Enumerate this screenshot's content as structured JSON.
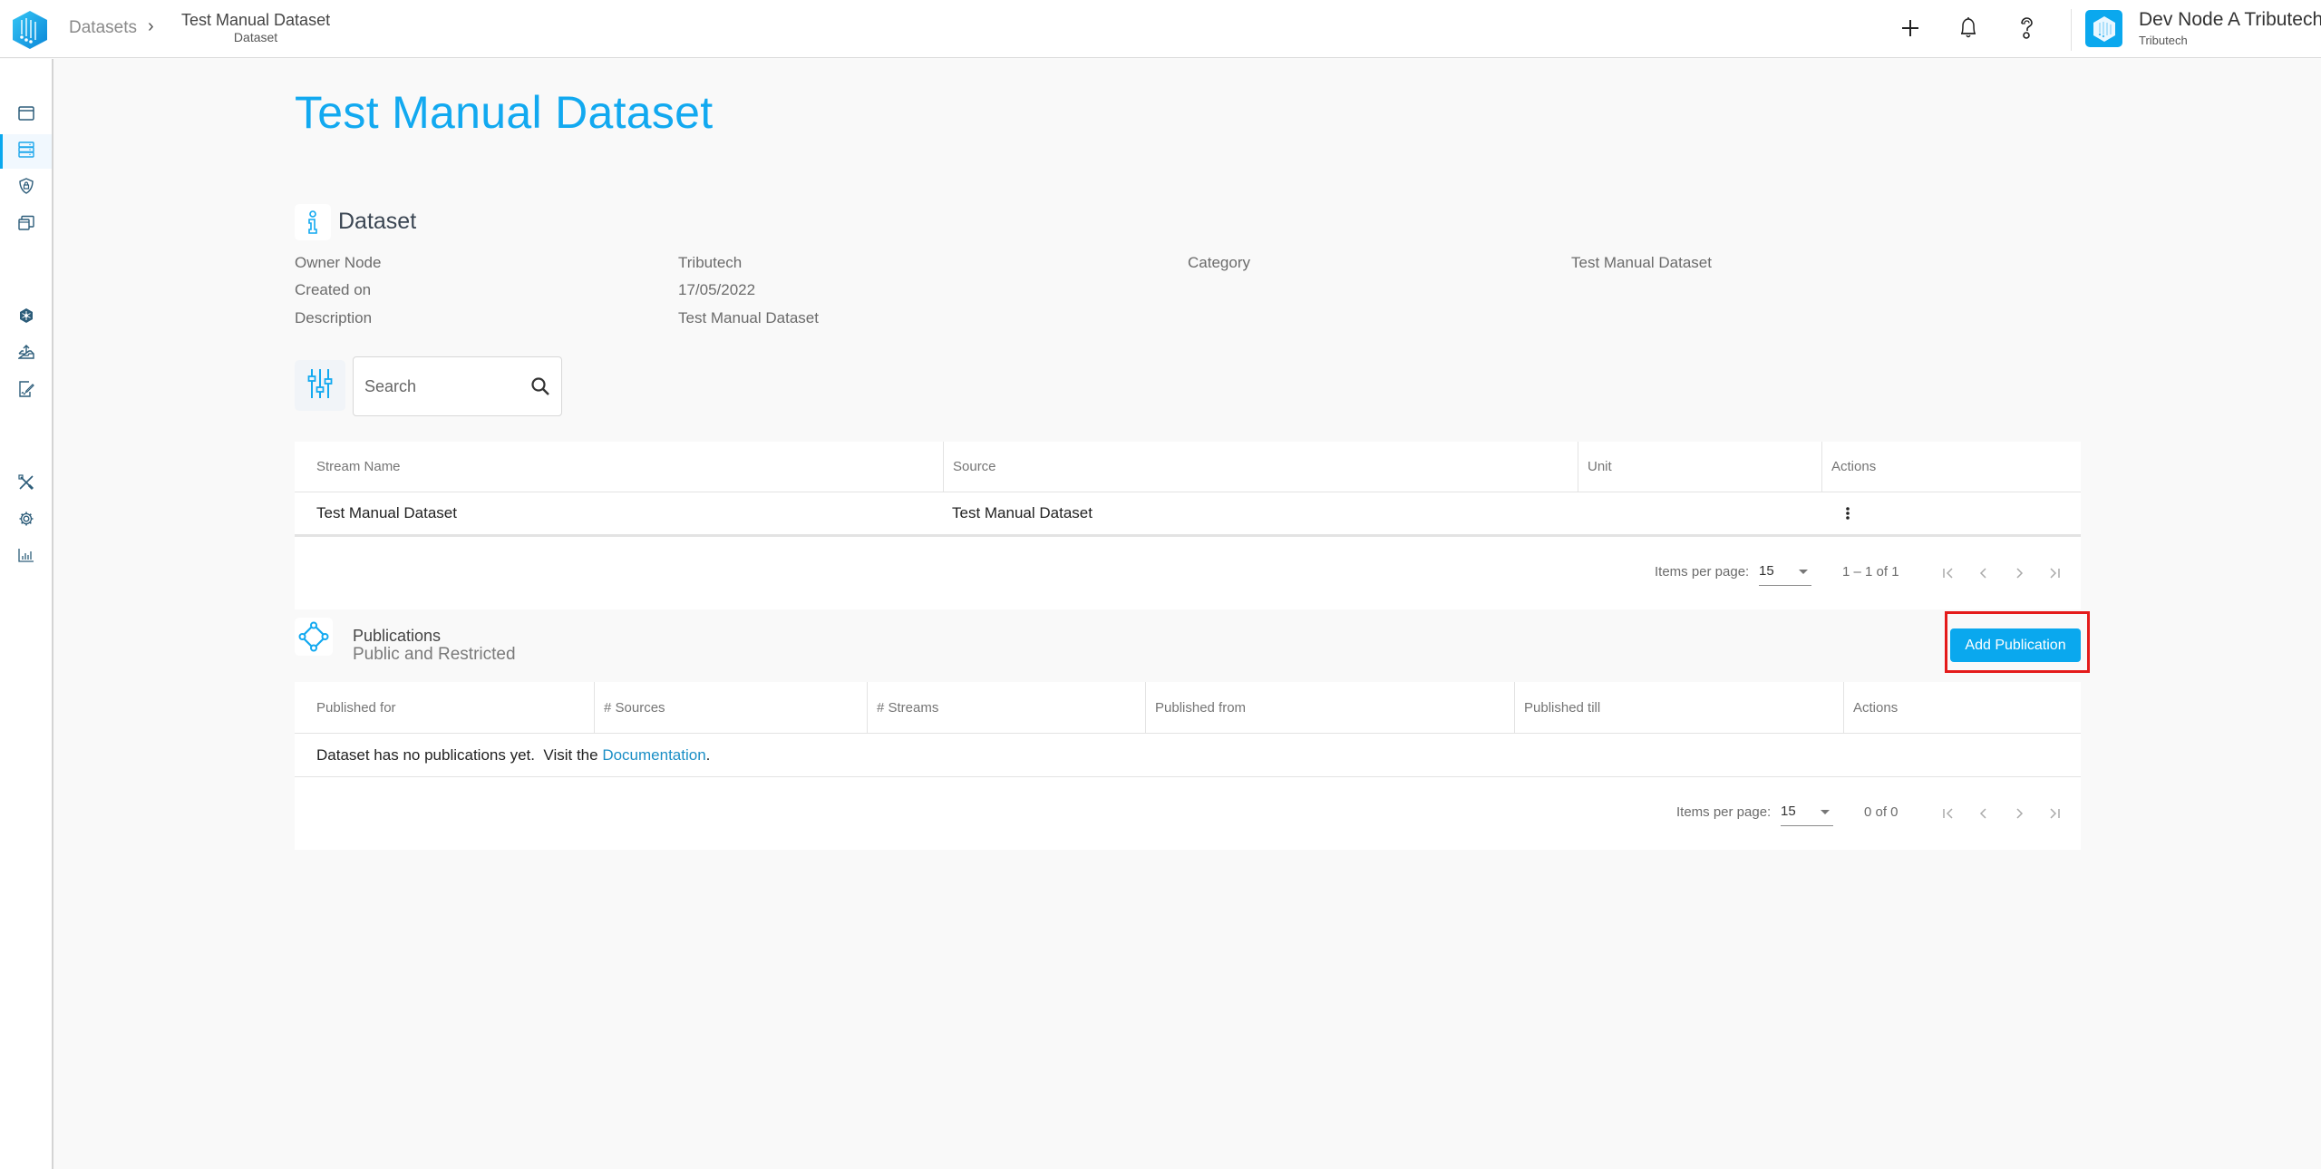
{
  "header": {
    "breadcrumb": {
      "root": "Datasets",
      "separator": "›",
      "current_title": "Test Manual Dataset",
      "current_subtitle": "Dataset"
    },
    "icons": [
      "plus-icon",
      "bell-icon",
      "help-icon"
    ],
    "user": {
      "name": "Dev Node A Tributech",
      "org": "Tributech"
    }
  },
  "sidebar": {
    "items": [
      {
        "icon": "window-icon",
        "active": false
      },
      {
        "icon": "datasets-icon",
        "active": true
      },
      {
        "icon": "shield-lock-icon",
        "active": false
      },
      {
        "icon": "stacked-windows-icon",
        "active": false
      },
      {
        "icon": "network-cube-icon",
        "active": false
      },
      {
        "icon": "upload-tray-icon",
        "active": false
      },
      {
        "icon": "document-edit-icon",
        "active": false
      },
      {
        "icon": "tools-icon",
        "active": false
      },
      {
        "icon": "gear-icon",
        "active": false
      },
      {
        "icon": "bar-chart-icon",
        "active": false
      }
    ]
  },
  "page": {
    "title": "Test Manual Dataset",
    "section_title": "Dataset",
    "meta": {
      "owner_node_label": "Owner Node",
      "owner_node_value": "Tributech",
      "created_on_label": "Created on",
      "created_on_value": "17/05/2022",
      "description_label": "Description",
      "description_value": "Test Manual Dataset",
      "category_label": "Category",
      "category_value": "Test Manual Dataset"
    },
    "search": {
      "placeholder": "Search",
      "value": ""
    }
  },
  "streams_table": {
    "columns": [
      "Stream Name",
      "Source",
      "Unit",
      "Actions"
    ],
    "rows": [
      {
        "stream_name": "Test Manual Dataset",
        "source": "Test Manual Dataset",
        "unit": "",
        "actions": "more-vert-icon"
      }
    ],
    "paginator": {
      "items_per_page_label": "Items per page:",
      "items_per_page": "15",
      "range": "1 – 1 of 1"
    }
  },
  "publications": {
    "title": "Publications",
    "subtitle": "Public and Restricted",
    "add_button": "Add Publication",
    "columns": [
      "Published for",
      "# Sources",
      "# Streams",
      "Published from",
      "Published till",
      "Actions"
    ],
    "empty_text": "Dataset has no publications yet.  Visit the ",
    "empty_link": "Documentation",
    "empty_suffix": ".",
    "paginator": {
      "items_per_page_label": "Items per page:",
      "items_per_page": "15",
      "range": "0 of 0"
    }
  },
  "colors": {
    "accent": "#0aa8ee",
    "title": "#12a9f0",
    "highlight": "#e41b1b",
    "link": "#1c8fc6"
  }
}
